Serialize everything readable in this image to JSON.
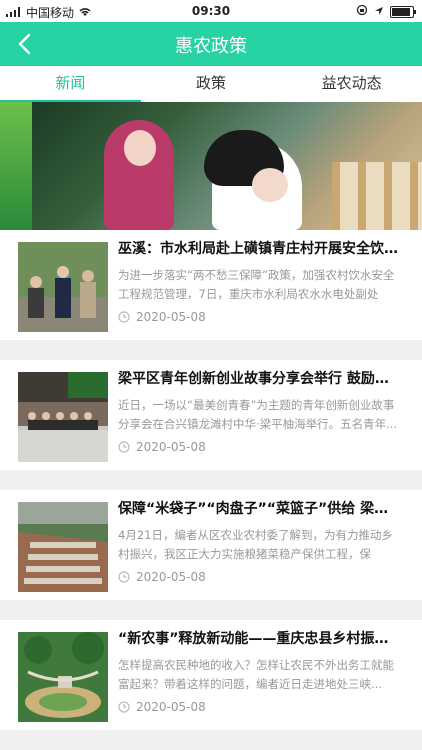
{
  "status_bar": {
    "carrier": "中国移动",
    "time": "09:30"
  },
  "header": {
    "title": "惠农政策"
  },
  "tabs": [
    {
      "label": "新闻",
      "active": true
    },
    {
      "label": "政策",
      "active": false
    },
    {
      "label": "益农动态",
      "active": false
    }
  ],
  "banner": {
    "page_count": 2,
    "active_index": 0
  },
  "articles": [
    {
      "title": "巫溪：市水利局赴上磺镇青庄村开展安全饮...",
      "summary": "为进一步落实“两不愁三保障”政策，加强农村饮水安全工程规范管理，7日，重庆市水利局农水水电处副处长...",
      "date": "2020-05-08"
    },
    {
      "title": "梁平区青年创新创业故事分享会举行 鼓励创...",
      "summary": "近日，一场以“最美创青春”为主题的青年创新创业故事分享会在合兴镇龙滩村中华·梁平柚海举行。五名青年...",
      "date": "2020-05-08"
    },
    {
      "title": "保障“米袋子”“肉盘子”“菜篮子”供给 梁平区...",
      "summary": "4月21日，编者从区农业农村委了解到，为有力推动乡村振兴，我区正大力实施粮猪菜稳产保供工程，保障“...",
      "date": "2020-05-08"
    },
    {
      "title": "“新农事”释放新动能——重庆忠县乡村振兴见闻",
      "summary": "怎样提高农民种地的收入？怎样让农民不外出务工就能富起来？带着这样的问题，编者近日走进地处三峡...",
      "date": "2020-05-08"
    }
  ],
  "colors": {
    "brand": "#27d3a5",
    "tab_active": "#1fc39a"
  }
}
